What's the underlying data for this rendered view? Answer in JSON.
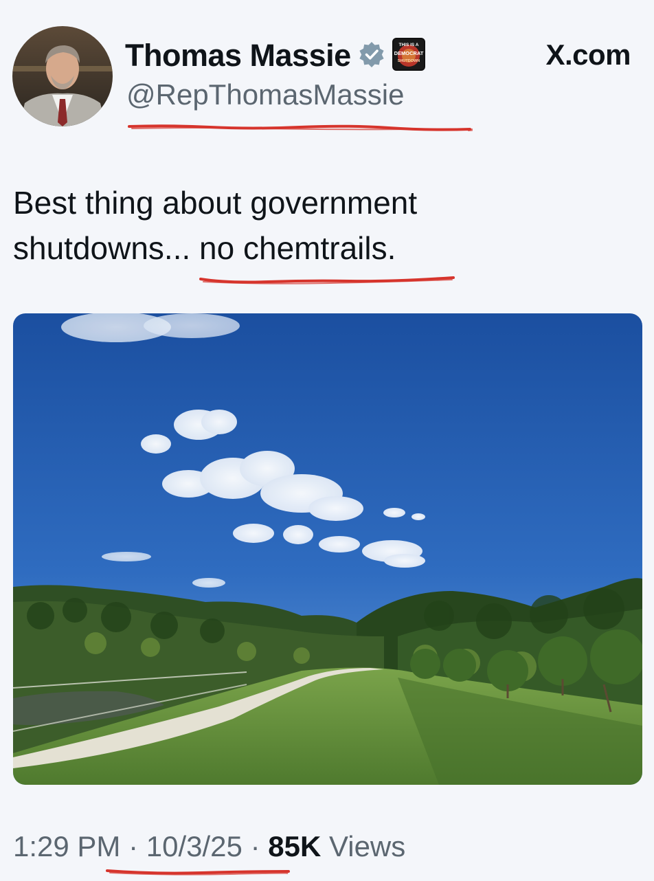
{
  "site": {
    "label": "X.com"
  },
  "author": {
    "display_name": "Thomas Massie",
    "handle": "@RepThomasMassie",
    "badge": {
      "line1": "THIS IS A",
      "line2": "DEMOCRAT",
      "line3": "SHUTDOWN"
    }
  },
  "tweet": {
    "text_line1": "Best thing about government",
    "text_line2": "shutdowns... no chemtrails."
  },
  "meta": {
    "time": "1:29 PM",
    "separator": "·",
    "date": "10/3/25",
    "views_count": "85K",
    "views_label": "Views"
  },
  "colors": {
    "verified": "#829aab",
    "annotation_red": "#d6342c",
    "sky_top": "#1b4fa0",
    "sky_bottom": "#5a94d6",
    "grass": "#5f8a3a"
  },
  "icons": {
    "verified": "verified-badge-icon",
    "affiliate": "affiliate-badge-icon"
  }
}
